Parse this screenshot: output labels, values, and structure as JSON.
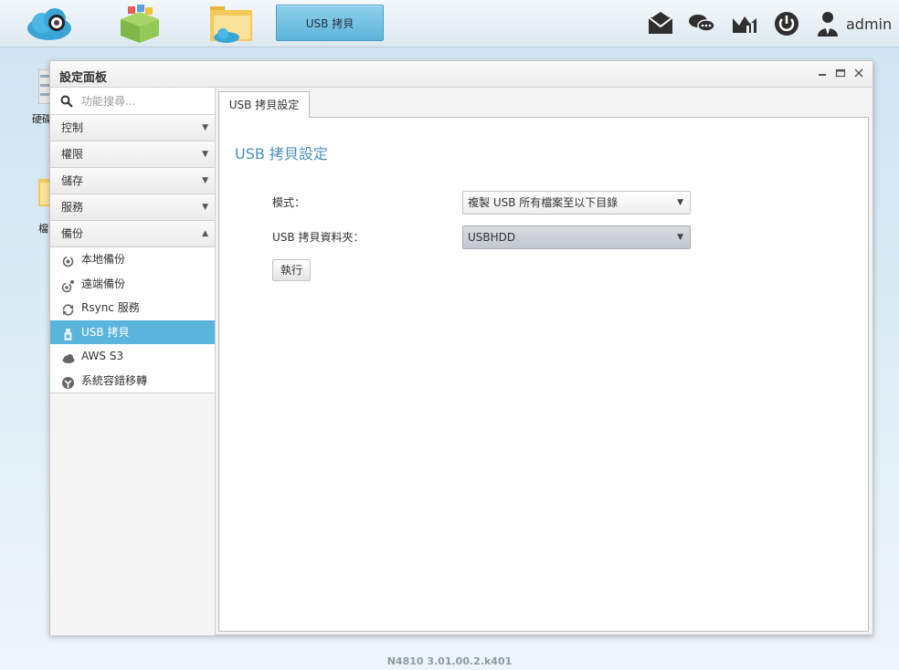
{
  "taskbar": {
    "active_task": "USB 拷貝",
    "user": "admin"
  },
  "desktop": {
    "icon1_label": "硬碟",
    "icon2_label": "檔"
  },
  "window": {
    "title": "設定面板"
  },
  "sidebar": {
    "search_placeholder": "功能搜尋...",
    "categories": [
      {
        "label": "控制"
      },
      {
        "label": "權限"
      },
      {
        "label": "儲存"
      },
      {
        "label": "服務"
      },
      {
        "label": "備份"
      }
    ],
    "backup_items": [
      {
        "label": "本地備份",
        "icon": "local-backup-icon"
      },
      {
        "label": "遠端備份",
        "icon": "remote-backup-icon"
      },
      {
        "label": "Rsync 服務",
        "icon": "rsync-icon"
      },
      {
        "label": "USB 拷貝",
        "icon": "usb-copy-icon"
      },
      {
        "label": "AWS S3",
        "icon": "cloud-icon"
      },
      {
        "label": "系統容錯移轉",
        "icon": "failover-icon"
      }
    ]
  },
  "content": {
    "tab_label": "USB 拷貝設定",
    "panel_title": "USB 拷貝設定",
    "mode_label": "模式：",
    "mode_value": "複製 USB 所有檔案至以下目錄",
    "folder_label": "USB 拷貝資料夾：",
    "folder_value": "USBHDD",
    "run_label": "執行"
  },
  "footer": {
    "version": "N4810   3.01.00.2.k401"
  },
  "colors": {
    "active": "#5bb4dc",
    "title_blue": "#4a8fbf"
  }
}
